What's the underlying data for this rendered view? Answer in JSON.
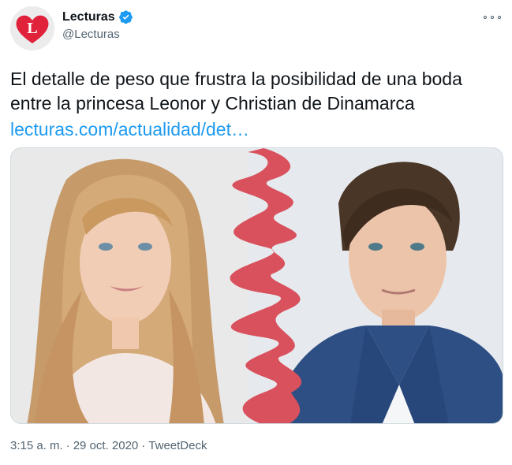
{
  "account": {
    "display_name": "Lecturas",
    "handle": "@Lecturas",
    "avatar_letter": "L",
    "brand_color": "#e0223b",
    "verified": true
  },
  "tweet": {
    "text": "El detalle de peso que frustra la posibilidad de una boda entre la princesa Leonor y Christian de Dinamarca",
    "link": "lecturas.com/actualidad/det…",
    "link_color": "#1d9bf0"
  },
  "meta": {
    "time": "3:15 a. m.",
    "separator": "·",
    "date": "29 oct. 2020",
    "source": "TweetDeck"
  },
  "icons": {
    "more": "more-horizontal-icon",
    "verified": "verified-badge-icon"
  }
}
